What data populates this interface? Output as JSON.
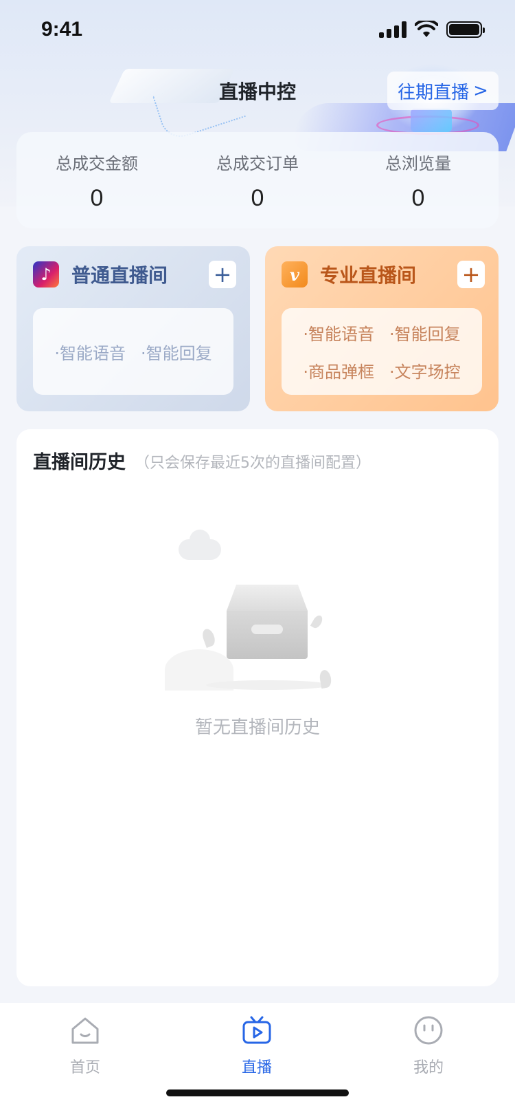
{
  "status_bar": {
    "time": "9:41"
  },
  "header": {
    "title": "直播中控",
    "past_live_label": "往期直播",
    "past_live_chevron": ">"
  },
  "stats": [
    {
      "label": "总成交金额",
      "value": "0"
    },
    {
      "label": "总成交订单",
      "value": "0"
    },
    {
      "label": "总浏览量",
      "value": "0"
    }
  ],
  "rooms": {
    "normal": {
      "title": "普通直播间",
      "icon": "tiktok-icon",
      "add": "+",
      "features": [
        "·智能语音",
        "·智能回复"
      ]
    },
    "pro": {
      "title": "专业直播间",
      "icon": "v-icon",
      "icon_glyph": "v",
      "add": "+",
      "features": [
        "·智能语音",
        "·智能回复",
        "·商品弹框",
        "·文字场控"
      ]
    }
  },
  "history": {
    "title": "直播间历史",
    "subtitle": "（只会保存最近5次的直播间配置）",
    "empty_text": "暂无直播间历史"
  },
  "tab_bar": {
    "tabs": [
      {
        "label": "首页",
        "icon": "home-icon",
        "active": false
      },
      {
        "label": "直播",
        "icon": "live-tv-icon",
        "active": true
      },
      {
        "label": "我的",
        "icon": "profile-face-icon",
        "active": false
      }
    ]
  },
  "colors": {
    "accent": "#2766e6",
    "pro_accent": "#b9561a",
    "normal_accent": "#3f5a8f"
  }
}
